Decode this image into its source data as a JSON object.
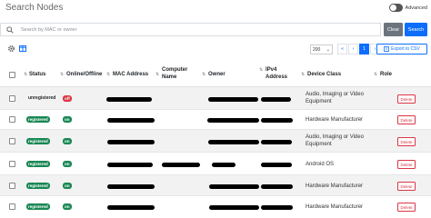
{
  "header": {
    "title": "Search Nodes",
    "advanced_label": "Advanced"
  },
  "search": {
    "placeholder": "Search by MAC or owner",
    "value": "",
    "clear_label": "Clear",
    "search_label": "Search"
  },
  "toolbar": {
    "per_page": "200",
    "pages": [
      "«",
      "‹",
      "1",
      "›"
    ],
    "current_page": "1",
    "export_label": "Export to CSV"
  },
  "table": {
    "columns": {
      "status": "Status",
      "online": "Online/Offline",
      "mac": "MAC Address",
      "computer_name_1": "Computer",
      "computer_name_2": "Name",
      "owner": "Owner",
      "ipv4_1": "IPv4",
      "ipv4_2": "Address",
      "device_class": "Device Class",
      "role": "Role"
    },
    "rows": [
      {
        "status": "unregistered",
        "online": "off",
        "device_class": "Audio, Imaging or Video Equipment",
        "delete": "Delete"
      },
      {
        "status": "registered",
        "online": "on",
        "device_class": "Hardware Manufacturer",
        "delete": "Delete"
      },
      {
        "status": "registered",
        "online": "on",
        "device_class": "Audio, Imaging or Video Equipment",
        "delete": "Delete"
      },
      {
        "status": "registered",
        "online": "on",
        "device_class": "Android OS",
        "delete": "Delete"
      },
      {
        "status": "registered",
        "online": "on",
        "device_class": "Hardware Manufacturer",
        "delete": "Delete"
      },
      {
        "status": "registered",
        "online": "on",
        "device_class": "Hardware Manufacturer",
        "delete": "Delete"
      }
    ]
  },
  "colors": {
    "primary": "#0d6efd",
    "success": "#198754",
    "danger": "#dc3545",
    "secondary": "#6c757d"
  }
}
